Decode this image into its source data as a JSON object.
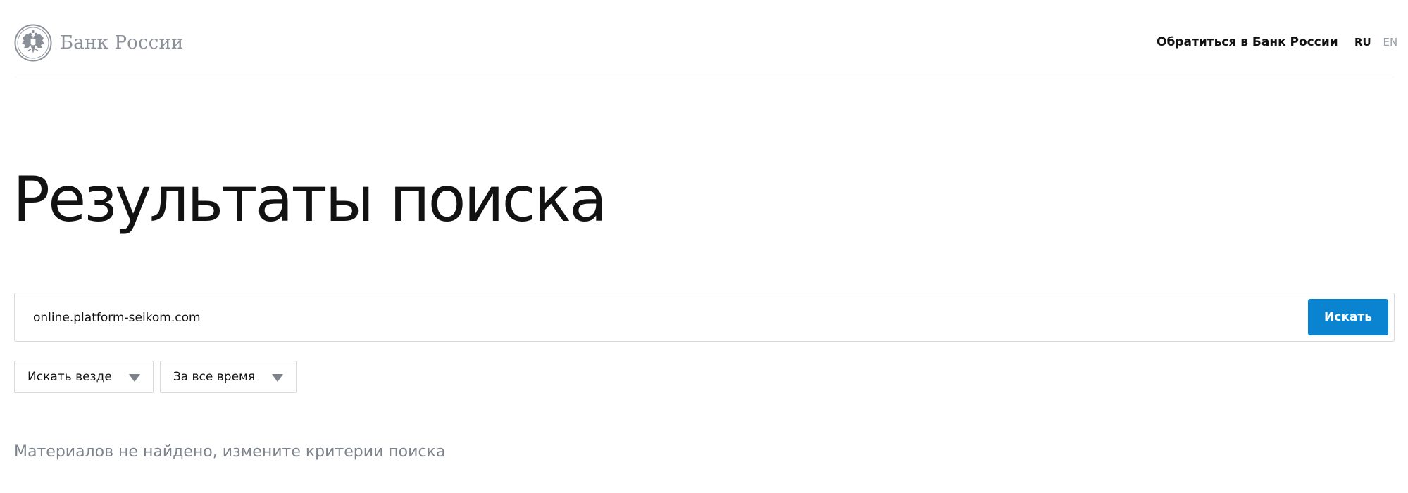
{
  "header": {
    "logo_text": "Банк России",
    "contact_link": "Обратиться в Банк России",
    "lang_ru": "RU",
    "lang_en": "EN"
  },
  "main": {
    "title": "Результаты поиска",
    "search": {
      "value": "online.platform-seikom.com",
      "button_label": "Искать"
    },
    "filters": [
      {
        "label": "Искать везде"
      },
      {
        "label": "За все время"
      }
    ],
    "empty_message": "Материалов не найдено, измените критерии поиска"
  },
  "colors": {
    "accent": "#0a84d0",
    "muted_text": "#7d838b",
    "border": "#d7d9dc"
  },
  "icons": {
    "logo": "double-headed-eagle-emblem-icon",
    "dropdown": "triangle-down-icon"
  }
}
